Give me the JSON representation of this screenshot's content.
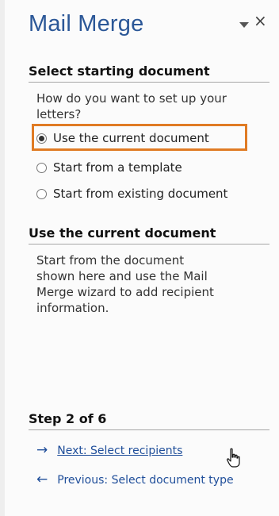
{
  "pane": {
    "title": "Mail Merge",
    "menu_icon": "chevron-down-icon",
    "close_glyph": "×"
  },
  "select_section": {
    "header": "Select starting document",
    "question": "How do you want to set up your letters?",
    "options": [
      {
        "label": "Use the current document",
        "checked": true
      },
      {
        "label": "Start from a template",
        "checked": false
      },
      {
        "label": "Start from existing document",
        "checked": false
      }
    ]
  },
  "current_section": {
    "header": "Use the current document",
    "description": "Start from the document shown here and use the Mail Merge wizard to add recipient information."
  },
  "step": {
    "label": "Step 2 of 6",
    "next_arrow": "→",
    "next_label": "Next: Select recipients",
    "prev_arrow": "←",
    "prev_label": "Previous: Select document type"
  },
  "colors": {
    "title": "#2b5797",
    "highlight": "#e07b24",
    "link": "#1f4e9a"
  }
}
